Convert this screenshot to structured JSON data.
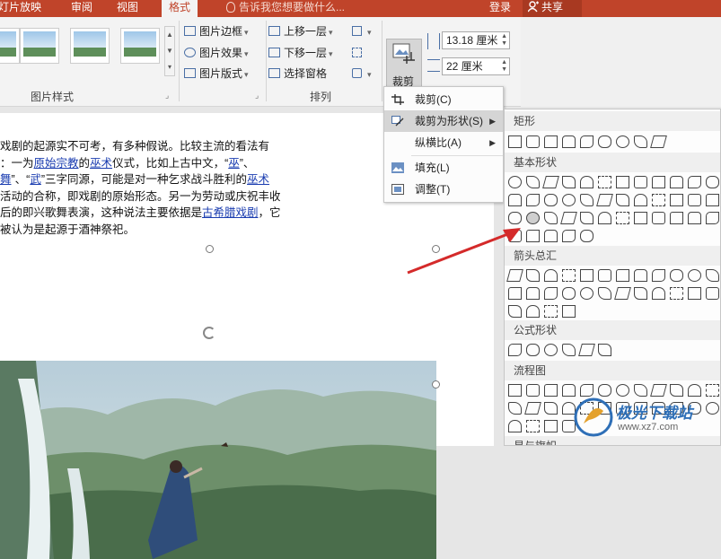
{
  "tabs": [
    {
      "label": "灯片放映"
    },
    {
      "label": "审阅"
    },
    {
      "label": "视图"
    },
    {
      "label": "格式"
    }
  ],
  "tell_me": "告诉我您想要做什么...",
  "login_label": "登录",
  "share_label": "共享",
  "ribbon": {
    "picture_styles_label": "图片样式",
    "arrange_label": "排列",
    "picture_border": "图片边框",
    "picture_effect": "图片效果",
    "picture_layout": "图片版式",
    "bring_forward": "上移一层",
    "send_backward": "下移一层",
    "selection_pane": "选择窗格",
    "crop_label": "裁剪",
    "height_value": "13.18 厘米",
    "width_value": "22 厘米"
  },
  "document": {
    "lines": [
      [
        {
          "t": "戏剧的起源实不可考，有多种假说。比较主流的看法有"
        }
      ],
      [
        {
          "t": "：一为"
        },
        {
          "t": "原始宗教",
          "link": true
        },
        {
          "t": "的"
        },
        {
          "t": "巫术",
          "link": true
        },
        {
          "t": "仪式，比如上古中文，“"
        },
        {
          "t": "巫",
          "link": true
        },
        {
          "t": "”、"
        }
      ],
      [
        {
          "t": "舞",
          "link": true
        },
        {
          "t": "”、“"
        },
        {
          "t": "武",
          "link": true
        },
        {
          "t": "”三字同源，可能是对一种乞求战斗胜利的"
        },
        {
          "t": "巫术",
          "link": true
        }
      ],
      [
        {
          "t": "活动的合称，即戏剧的原始形态。另一为劳动或庆祝丰收"
        }
      ],
      [
        {
          "t": "后的即兴歌舞表演，这种说法主要依据是"
        },
        {
          "t": "古希腊戏剧",
          "link": true
        },
        {
          "t": "，它"
        }
      ],
      [
        {
          "t": "被认为是起源于酒神祭祀。"
        }
      ]
    ]
  },
  "crop_menu": [
    {
      "label": "裁剪(C)",
      "icon": "crop-icon",
      "submenu": false
    },
    {
      "label": "裁剪为形状(S)",
      "icon": "crop-to-shape-icon",
      "submenu": true
    },
    {
      "label": "纵横比(A)",
      "icon": "",
      "submenu": true
    },
    {
      "label": "填充(L)",
      "icon": "fill-icon",
      "submenu": false
    },
    {
      "label": "调整(T)",
      "icon": "fit-icon",
      "submenu": false
    }
  ],
  "shapes_panel": {
    "sections": [
      {
        "title": "矩形"
      },
      {
        "title": "基本形状"
      },
      {
        "title": "箭头总汇"
      },
      {
        "title": "公式形状"
      },
      {
        "title": "流程图"
      },
      {
        "title": "星与旗帜"
      }
    ]
  },
  "watermark": {
    "title": "极光下载站",
    "url": "www.xz7.com"
  },
  "colors": {
    "accent": "#c0442a",
    "link": "#1a3cb0",
    "arrow": "#d42a2a"
  }
}
